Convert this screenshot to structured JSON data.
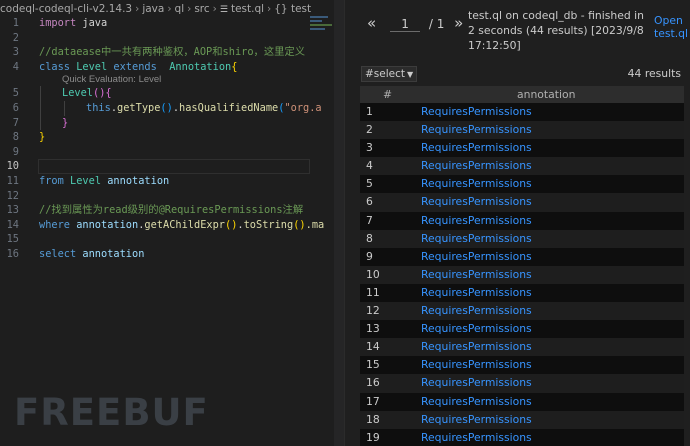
{
  "editor": {
    "breadcrumb": [
      "codeql-codeql-cli-v2.14.3",
      "java",
      "ql",
      "src",
      "test.ql",
      "{} test"
    ],
    "hint": "Quick Evaluation: Level",
    "current_line": "10",
    "line_numbers": [
      "1",
      "2",
      "3",
      "4",
      "5",
      "6",
      "7",
      "8",
      "9",
      "10",
      "11",
      "12",
      "13",
      "14",
      "15",
      "16"
    ]
  },
  "results": {
    "page_prev": "«",
    "page_current": "1",
    "page_total": "/ 1",
    "page_next": "»",
    "status": "test.ql on codeql_db - finished in 2 seconds (44 results) [2023/9/8 17:12:50]",
    "open_link": "Open test.ql",
    "select_label": "#select",
    "result_count": "44 results",
    "columns": [
      "#",
      "annotation"
    ],
    "rows": [
      {
        "num": "1",
        "value": "RequiresPermissions"
      },
      {
        "num": "2",
        "value": "RequiresPermissions"
      },
      {
        "num": "3",
        "value": "RequiresPermissions"
      },
      {
        "num": "4",
        "value": "RequiresPermissions"
      },
      {
        "num": "5",
        "value": "RequiresPermissions"
      },
      {
        "num": "6",
        "value": "RequiresPermissions"
      },
      {
        "num": "7",
        "value": "RequiresPermissions"
      },
      {
        "num": "8",
        "value": "RequiresPermissions"
      },
      {
        "num": "9",
        "value": "RequiresPermissions"
      },
      {
        "num": "10",
        "value": "RequiresPermissions"
      },
      {
        "num": "11",
        "value": "RequiresPermissions"
      },
      {
        "num": "12",
        "value": "RequiresPermissions"
      },
      {
        "num": "13",
        "value": "RequiresPermissions"
      },
      {
        "num": "14",
        "value": "RequiresPermissions"
      },
      {
        "num": "15",
        "value": "RequiresPermissions"
      },
      {
        "num": "16",
        "value": "RequiresPermissions"
      },
      {
        "num": "17",
        "value": "RequiresPermissions"
      },
      {
        "num": "18",
        "value": "RequiresPermissions"
      },
      {
        "num": "19",
        "value": "RequiresPermissions"
      }
    ]
  },
  "code": {
    "l1": {
      "kw": "import",
      "rest": " java"
    },
    "l3": "//dataease中一共有两种鉴权，AOP和shiro，这里定义",
    "l4": {
      "kw": "class",
      "ty": "Level",
      "kw2": "extends",
      "ty2": "Annotation",
      "br": "{"
    },
    "l5": {
      "ty": "Level",
      "br": "(){"
    },
    "l6": {
      "kw": "this",
      "p1": ".",
      "fn1": "getType",
      "br1": "()",
      "p2": ".",
      "fn2": "hasQualifiedName",
      "br2": "(",
      "st": "\"org.a"
    },
    "l7": "}",
    "l8": "}",
    "l11": {
      "kw": "from",
      "ty": "Level",
      "va": "annotation"
    },
    "l13": "//找到属性为read级别的@RequiresPermissions注解",
    "l14": {
      "kw": "where",
      "va": "annotation",
      "fn1": "getAChildExpr",
      "br1": "()",
      "fn2": "toString",
      "br2": "()",
      "tail": ".ma"
    },
    "l16": {
      "kw": "select",
      "va": "annotation"
    }
  },
  "watermark": "FREEBUF"
}
